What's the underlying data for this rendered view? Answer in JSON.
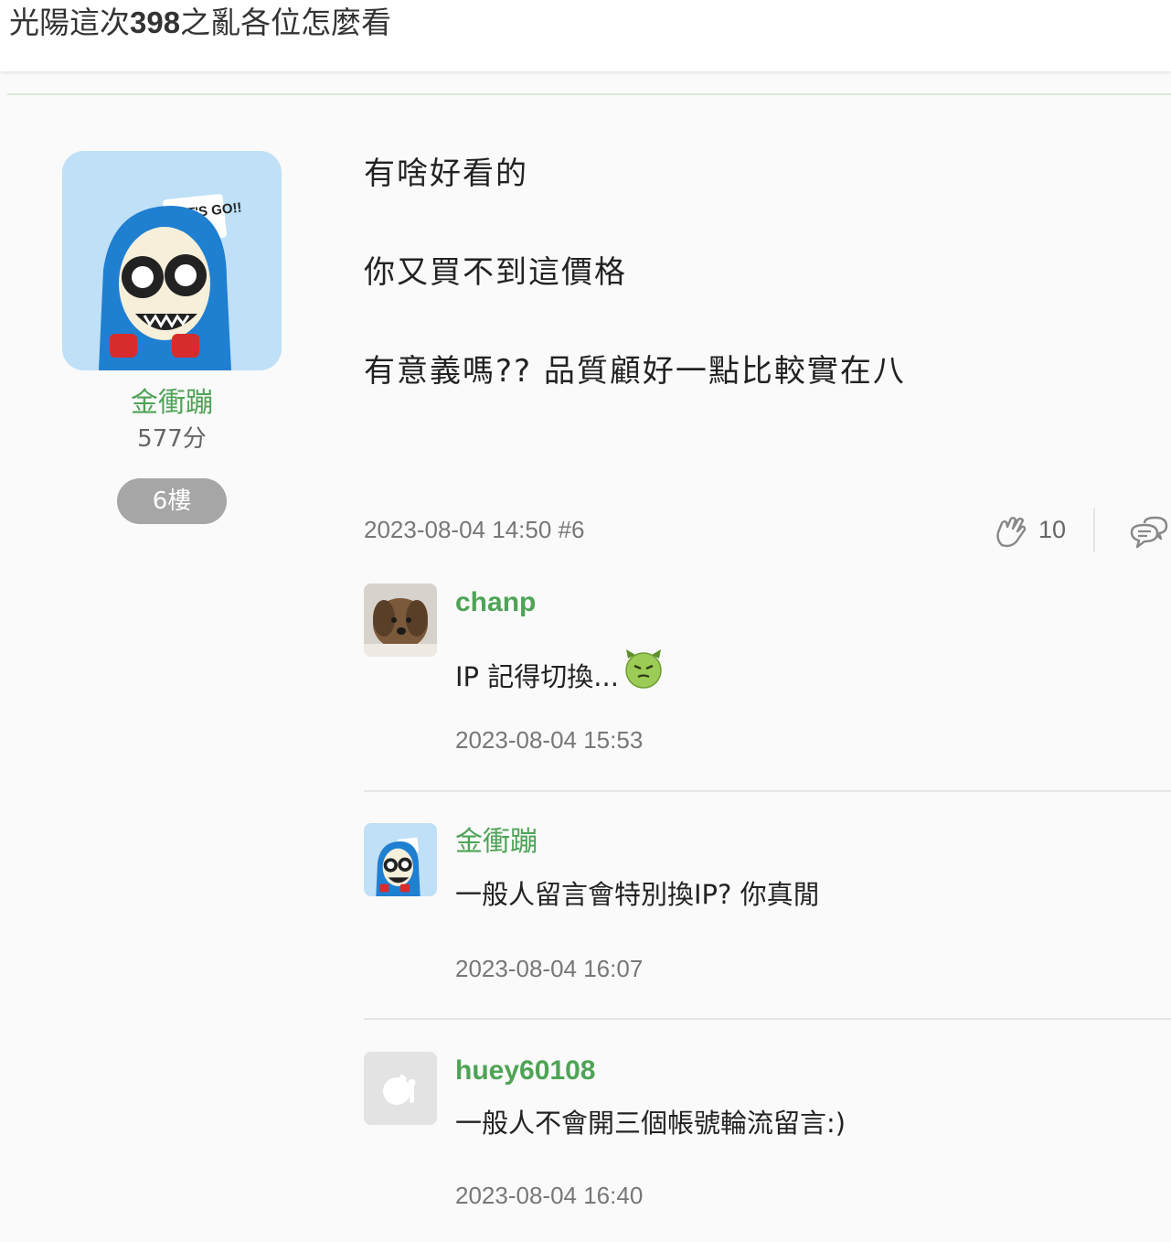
{
  "header": {
    "title_pre": "光陽這次",
    "title_bold": "398",
    "title_post": "之亂各位怎麼看"
  },
  "author": {
    "name": "金衝蹦",
    "score": "577分",
    "floor": "6樓",
    "avatar_badge": "LET'S GO!!"
  },
  "post": {
    "lines": [
      "有啥好看的",
      "你又買不到這價格",
      "有意義嗎?? 品質顧好一點比較實在八"
    ],
    "datetime": "2023-08-04 14:50 #6",
    "claps": "10"
  },
  "comments": [
    {
      "user": "chanp",
      "text": "IP 記得切換...",
      "emoji": "devil-face-emoji",
      "time": "2023-08-04 15:53"
    },
    {
      "user": "金衝蹦",
      "text": "一般人留言會特別換IP? 你真閒",
      "time": "2023-08-04 16:07"
    },
    {
      "user": "huey60108",
      "text": "一般人不會開三個帳號輪流留言:)",
      "time": "2023-08-04 16:40"
    }
  ],
  "colors": {
    "accent_green": "#4fa356",
    "badge_gray": "#a6a6a6",
    "meta_gray": "#777777"
  },
  "icons": {
    "clap": "clap-icon",
    "reply": "reply-icon"
  }
}
